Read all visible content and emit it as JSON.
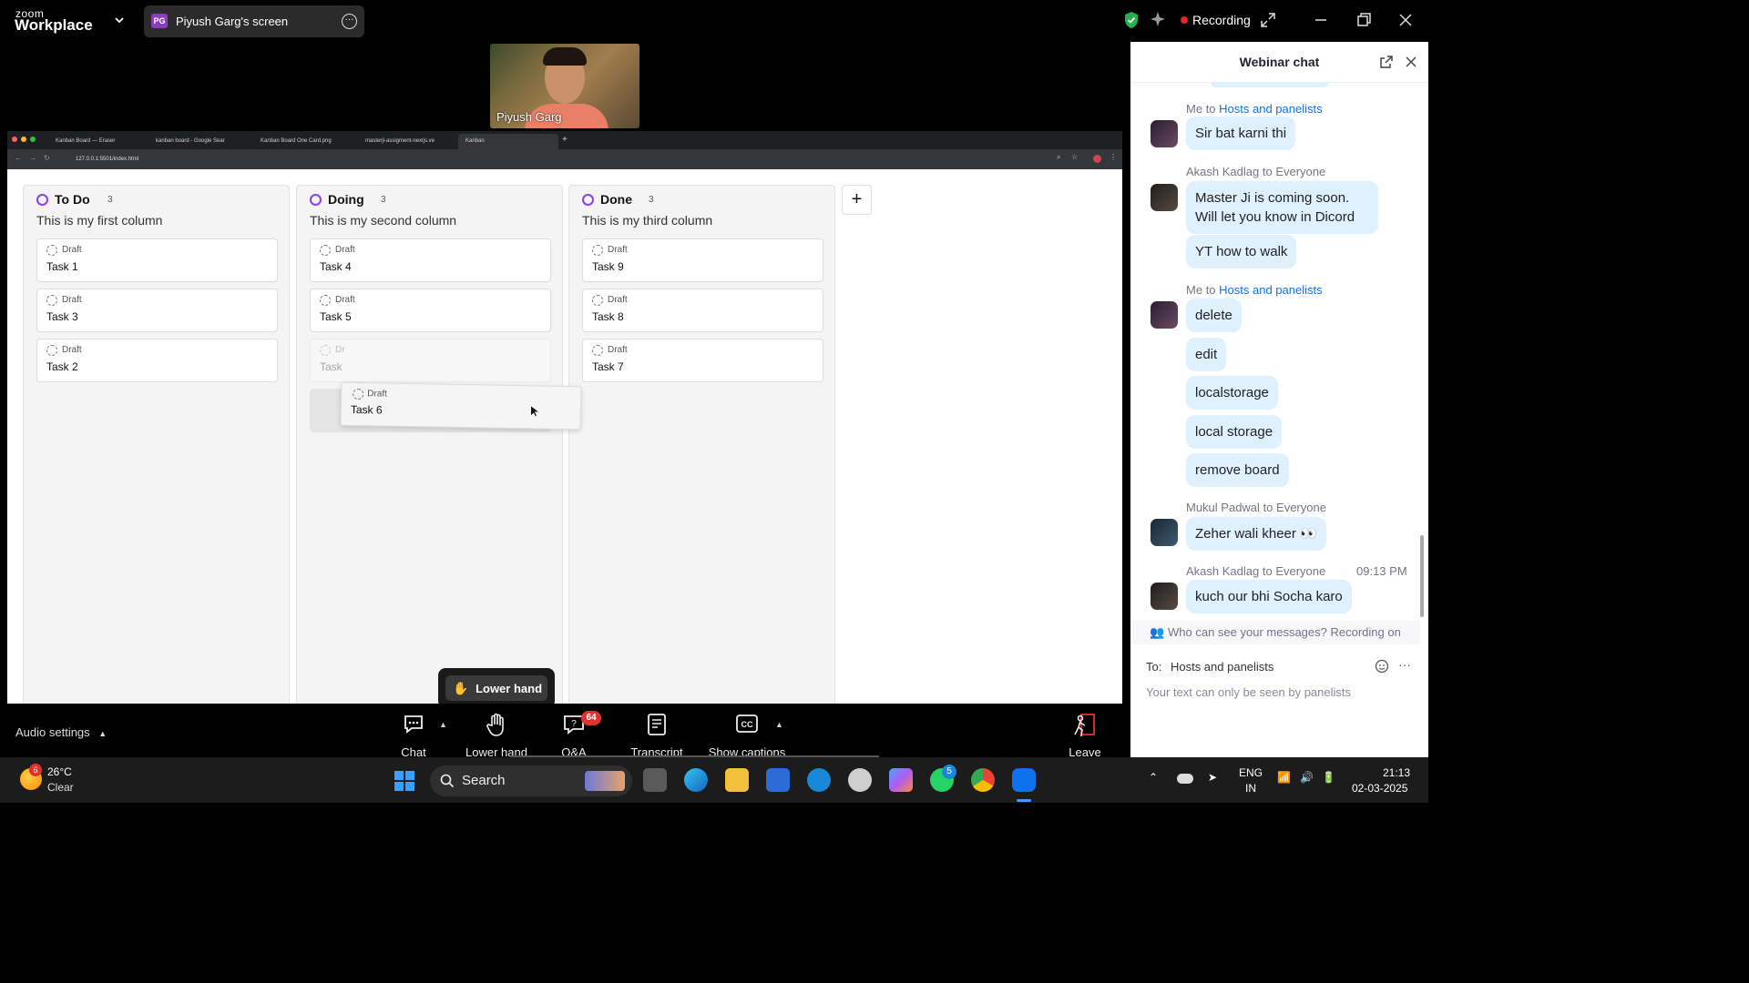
{
  "app": {
    "brand_small": "zoom",
    "brand_large": "Workplace",
    "share_initials": "PG",
    "share_label": "Piyush Garg's screen",
    "recording_label": "Recording",
    "recording_color": "#e02828"
  },
  "speaker": {
    "name": "Piyush Garg"
  },
  "browser": {
    "tabs": [
      {
        "label": "Kanban Board — Eraser"
      },
      {
        "label": "kanban board - Google Sear"
      },
      {
        "label": "Kanban Board One Card.png"
      },
      {
        "label": "masterji-assigment-nextjs.ve"
      },
      {
        "label": "Kanban"
      }
    ],
    "url": "127.0.0.1:5501/index.html"
  },
  "board": {
    "accent": "#8a3ff0",
    "columns": [
      {
        "title": "To Do",
        "count": "3",
        "subtitle": "This is my first column",
        "cards": [
          {
            "status": "Draft",
            "name": "Task 1"
          },
          {
            "status": "Draft",
            "name": "Task 3"
          },
          {
            "status": "Draft",
            "name": "Task 2"
          }
        ]
      },
      {
        "title": "Doing",
        "count": "3",
        "subtitle": "This is my second column",
        "cards": [
          {
            "status": "Draft",
            "name": "Task 4"
          },
          {
            "status": "Draft",
            "name": "Task 5"
          },
          {
            "status": "Dr",
            "name": "Task"
          }
        ]
      },
      {
        "title": "Done",
        "count": "3",
        "subtitle": "This is my third column",
        "cards": [
          {
            "status": "Draft",
            "name": "Task 9"
          },
          {
            "status": "Draft",
            "name": "Task 8"
          },
          {
            "status": "Draft",
            "name": "Task 7"
          }
        ]
      }
    ],
    "dragging_card": {
      "status": "Draft",
      "name": "Task 6"
    },
    "add_column_label": "+"
  },
  "lower_hand_popup": "Lower hand",
  "toolbar": {
    "audio_settings": "Audio settings",
    "chat": "Chat",
    "lower_hand": "Lower hand",
    "qa": "Q&A",
    "qa_badge": "64",
    "transcript": "Transcript",
    "show_captions": "Show captions",
    "leave": "Leave"
  },
  "chat": {
    "title": "Webinar chat",
    "groups": [
      {
        "from": "Me",
        "to": "Hosts and panelists",
        "time": "",
        "messages": [
          "Sir bat karni thi"
        ]
      },
      {
        "from": "Akash Kadlag",
        "to": "Everyone",
        "time": "",
        "messages": [
          "Master Ji is coming soon. Will let you know  in Dicord",
          "YT how to walk"
        ]
      },
      {
        "from": "Me",
        "to": "Hosts and panelists",
        "time": "",
        "messages": [
          "delete",
          "edit",
          "localstorage",
          "local storage",
          "remove board"
        ]
      },
      {
        "from": "Mukul Padwal",
        "to": "Everyone",
        "time": "",
        "messages": [
          "Zeher wali kheer 👀"
        ]
      },
      {
        "from": "Akash Kadlag",
        "to": "Everyone",
        "time": "09:13 PM",
        "messages": [
          "kuch our bhi Socha karo"
        ]
      }
    ],
    "connector": "to",
    "visibility_note": "Who can see your messages? Recording on",
    "to_label": "To:",
    "to_value": "Hosts and panelists",
    "input_placeholder": "Your text can only be seen by panelists"
  },
  "taskbar": {
    "weather_badge": "6",
    "temperature": "26°C",
    "condition": "Clear",
    "search": "Search",
    "whatsapp_badge": "5",
    "lang_top": "ENG",
    "lang_bottom": "IN",
    "time": "21:13",
    "date": "02-03-2025"
  }
}
